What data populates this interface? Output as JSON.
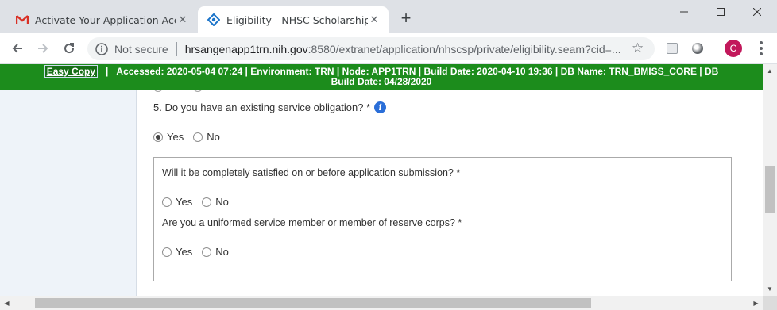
{
  "browser": {
    "tabs": [
      {
        "title": "Activate Your Application Accou",
        "favicon": "gmail-icon",
        "active": false
      },
      {
        "title": "Eligibility - NHSC Scholarship Pro",
        "favicon": "nhsc-icon",
        "active": true
      }
    ],
    "new_tab": "+",
    "window_controls": {
      "minimize": "–",
      "maximize": "☐",
      "close": "✕"
    },
    "security_label": "Not secure",
    "url_host": "hrsangenapp1trn.nih.gov",
    "url_path": ":8580/extranet/application/nhscsp/private/eligibility.seam?cid=...",
    "profile_initial": "C"
  },
  "env_bar": {
    "easy_copy": "Easy Copy",
    "line1": "Accessed: 2020-05-04 07:24   |   Environment: TRN   |   Node: APP1TRN   |   Build Date: 2020-04-10 19:36   |   DB Name: TRN_BMISS_CORE   |   DB",
    "line2": "Build Date: 04/28/2020",
    "separator": "|"
  },
  "form": {
    "prev_options": {
      "yes": "Yes",
      "no": "No"
    },
    "q5": {
      "label": "5. Do you have an existing service obligation? *",
      "help": "i",
      "yes": "Yes",
      "no": "No",
      "selected": "Yes"
    },
    "sub_questions": [
      {
        "label": "Will it be completely satisfied on or before application submission? *",
        "yes": "Yes",
        "no": "No",
        "selected": null
      },
      {
        "label": "Are you a uniformed service member or member of reserve corps? *",
        "yes": "Yes",
        "no": "No",
        "selected": null
      }
    ]
  }
}
